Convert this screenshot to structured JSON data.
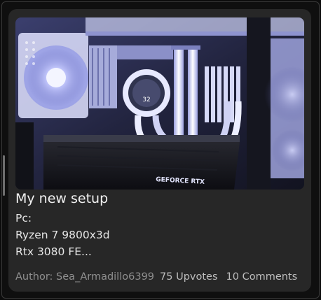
{
  "post": {
    "image_alt": "PC build with white liquid cooler and GeForce RTX graphics card",
    "image_texts": {
      "gpu_brand": "GEFORCE RTX",
      "pump_display": "32"
    },
    "title": "My new setup",
    "body_lines": [
      "Pc:",
      "Ryzen 7 9800x3d",
      "Rtx 3080 FE..."
    ],
    "author": "Author: Sea_Armadillo6399",
    "upvotes": "75 Upvotes",
    "comments": "10 Comments"
  },
  "colors": {
    "page_background": "#0c0c0c",
    "card_background": "#272727",
    "title_text": "#f1f1f1",
    "muted_text": "#8f8f8f"
  }
}
